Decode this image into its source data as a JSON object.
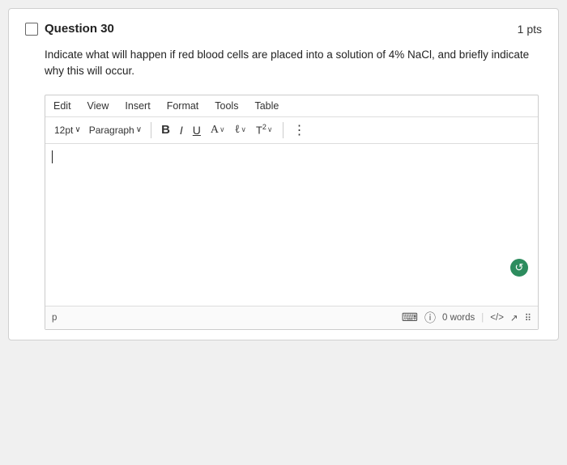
{
  "header": {
    "question_number": "Question 30",
    "points": "1 pts"
  },
  "question": {
    "text": "Indicate what will happen if red blood cells are placed into a solution of 4% NaCl, and briefly indicate why this will occur."
  },
  "editor": {
    "menu": {
      "edit": "Edit",
      "view": "View",
      "insert": "Insert",
      "format": "Format",
      "tools": "Tools",
      "table": "Table"
    },
    "toolbar": {
      "font_size": "12pt",
      "font_size_chevron": "∨",
      "paragraph": "Paragraph",
      "paragraph_chevron": "∨",
      "bold": "B",
      "italic": "I",
      "underline": "U",
      "font_color": "A",
      "font_color_chevron": "∨",
      "pencil": "𝓁",
      "pencil_chevron": "∨",
      "superscript": "T²",
      "superscript_chevron": "∨",
      "more": "⋮"
    },
    "status": {
      "left": "p",
      "word_count": "0 words",
      "code_tag": "</>",
      "expand_icon": "↗",
      "grid_icon": "⠿"
    }
  }
}
